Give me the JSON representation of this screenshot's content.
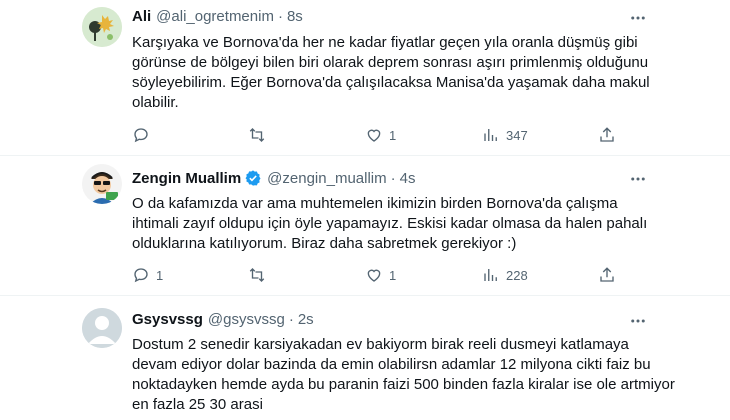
{
  "tweets": [
    {
      "name": "Ali",
      "handle": "@ali_ogretmenim",
      "time": "8s",
      "verified": false,
      "text": "Karşıyaka ve Bornova'da her ne kadar fiyatlar geçen yıla oranla düşmüş gibi görünse de bölgeyi bilen biri olarak deprem sonrası aşırı primlenmiş olduğunu söyleyebilirim. Eğer Bornova'da çalışılacaksa Manisa'da yaşamak daha makul olabilir.",
      "replies": "",
      "retweets": "",
      "likes": "1",
      "views": "347"
    },
    {
      "name": "Zengin Muallim",
      "handle": "@zengin_muallim",
      "time": "4s",
      "verified": true,
      "text": "O da kafamızda var ama muhtemelen ikimizin birden Bornova'da çalışma ihtimali zayıf oldupu için öyle yapamayız. Eskisi kadar olmasa da halen pahalı olduklarına katılıyorum. Biraz daha sabretmek gerekiyor :)",
      "replies": "1",
      "retweets": "",
      "likes": "1",
      "views": "228"
    },
    {
      "name": "Gsysvssg",
      "handle": "@gsysvssg",
      "time": "2s",
      "verified": false,
      "text": "Dostum 2 senedir karsiyakadan ev bakiyorm birak reeli dusmeyi katlamaya devam ediyor dolar bazinda da emin olabilirsn adamlar 12 milyona cikti faiz bu noktadayken hemde ayda bu paranin faizi 500 binden fazla kiralar ise ole artmiyor en fazla 25 30 arasi"
    }
  ],
  "colors": {
    "verified": "#1d9bf0",
    "muted": "#536471",
    "text": "#0f1419"
  },
  "icons": {
    "reply": "reply-icon",
    "retweet": "retweet-icon",
    "like": "heart-icon",
    "views": "views-icon",
    "share": "share-icon",
    "more": "more-icon"
  }
}
